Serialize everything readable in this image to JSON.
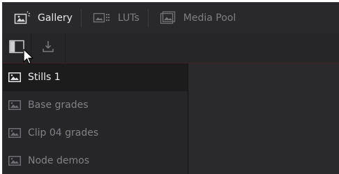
{
  "tabs": [
    {
      "label": "Gallery",
      "icon": "gallery-icon",
      "active": true
    },
    {
      "label": "LUTs",
      "icon": "luts-icon",
      "active": false
    },
    {
      "label": "Media Pool",
      "icon": "media-pool-icon",
      "active": false
    }
  ],
  "toolbar": {
    "buttons": [
      {
        "icon": "sidebar-toggle-icon"
      },
      {
        "icon": "import-icon"
      }
    ]
  },
  "albums": [
    {
      "label": "Stills 1",
      "icon": "still-album-icon",
      "active": true
    },
    {
      "label": "Base grades",
      "icon": "still-album-icon",
      "active": false
    },
    {
      "label": "Clip 04 grades",
      "icon": "still-album-icon",
      "active": false
    },
    {
      "label": "Node demos",
      "icon": "still-album-icon",
      "active": false
    }
  ],
  "colors": {
    "accent_line": "#4a1f24",
    "active_text": "#f0f0f2",
    "inactive_text": "#828286"
  }
}
